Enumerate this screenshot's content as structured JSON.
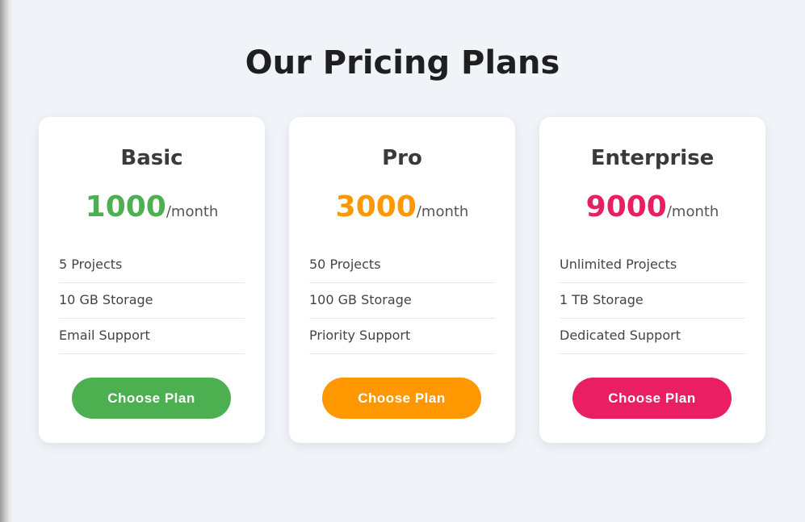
{
  "page": {
    "title": "Our Pricing Plans"
  },
  "plans": [
    {
      "name": "Basic",
      "price": "1000",
      "period": "/month",
      "accent": "#4caf50",
      "features": [
        "5 Projects",
        "10 GB Storage",
        "Email Support"
      ],
      "button_label": "Choose Plan"
    },
    {
      "name": "Pro",
      "price": "3000",
      "period": "/month",
      "accent": "#ff9800",
      "features": [
        "50 Projects",
        "100 GB Storage",
        "Priority Support"
      ],
      "button_label": "Choose Plan"
    },
    {
      "name": "Enterprise",
      "price": "9000",
      "period": "/month",
      "accent": "#e91e63",
      "features": [
        "Unlimited Projects",
        "1 TB Storage",
        "Dedicated Support"
      ],
      "button_label": "Choose Plan"
    }
  ]
}
